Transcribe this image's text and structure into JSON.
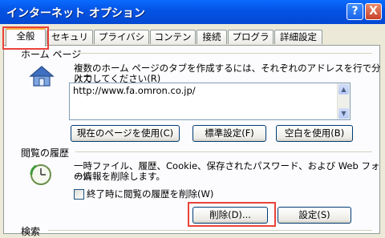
{
  "window": {
    "title": "インターネット オプション",
    "help_label": "?",
    "close_label": "X"
  },
  "tabs": [
    {
      "label": "全般"
    },
    {
      "label": "セキュリティ"
    },
    {
      "label": "プライバシー"
    },
    {
      "label": "コンテンツ"
    },
    {
      "label": "接続"
    },
    {
      "label": "プログラム"
    },
    {
      "label": "詳細設定"
    }
  ],
  "home": {
    "group_label": "ホーム ページ",
    "desc_line1": "複数のホーム ページのタブを作成するには、それぞれのアドレスを行で分けて",
    "desc_line2": "入力してください(R)",
    "url": "http://www.fa.omron.co.jp/",
    "use_current": "現在のページを使用(C)",
    "use_default": "標準設定(F)",
    "use_blank": "空白を使用(B)"
  },
  "history": {
    "group_label": "閲覧の履歴",
    "desc_line1": "一時ファイル、履歴、Cookie、保存されたパスワード、および Web フォーム",
    "desc_line2": "の情報を削除します。",
    "checkbox_label": "終了時に閲覧の履歴を削除(W)",
    "delete_button": "削除(D)...",
    "settings_button": "設定(S)"
  },
  "search": {
    "group_label": "検索"
  },
  "colors": {
    "highlight": "#e8433a",
    "titlebar": "#0454e6"
  }
}
